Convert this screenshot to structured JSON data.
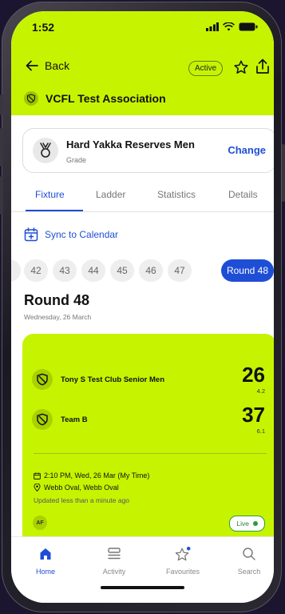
{
  "status_bar": {
    "time": "1:52"
  },
  "nav": {
    "back_label": "Back",
    "status_badge": "Active"
  },
  "association": {
    "title": "VCFL Test Association"
  },
  "grade": {
    "name": "Hard Yakka Reserves Men",
    "subtitle": "Grade",
    "change_label": "Change"
  },
  "tabs": [
    {
      "label": "Fixture",
      "active": true
    },
    {
      "label": "Ladder",
      "active": false
    },
    {
      "label": "Statistics",
      "active": false
    },
    {
      "label": "Details",
      "active": false
    }
  ],
  "sync": {
    "label": "Sync to Calendar"
  },
  "rounds": {
    "items": [
      "42",
      "43",
      "44",
      "45",
      "46",
      "47",
      "Round 48"
    ],
    "selected": "Round 48"
  },
  "round_heading": {
    "title": "Round 48",
    "date": "Wednesday, 26 March"
  },
  "match": {
    "home": {
      "name": "Tony S Test Club Senior Men",
      "score": "26",
      "detail": "4.2"
    },
    "away": {
      "name": "Team B",
      "score": "37",
      "detail": "6.1"
    },
    "time_line": "2:10 PM, Wed, 26 Mar (My Time)",
    "venue_line": "Webb Oval, Webb Oval",
    "updated": "Updated less than a minute ago",
    "avatar_initials": "AF",
    "live_label": "Live"
  },
  "bottom_nav": [
    {
      "label": "Home",
      "active": true
    },
    {
      "label": "Activity",
      "active": false
    },
    {
      "label": "Favourites",
      "active": false
    },
    {
      "label": "Search",
      "active": false
    }
  ],
  "colors": {
    "accent_lime": "#c6f400",
    "link_blue": "#1f4ed6",
    "live_green": "#2e9b3a"
  }
}
